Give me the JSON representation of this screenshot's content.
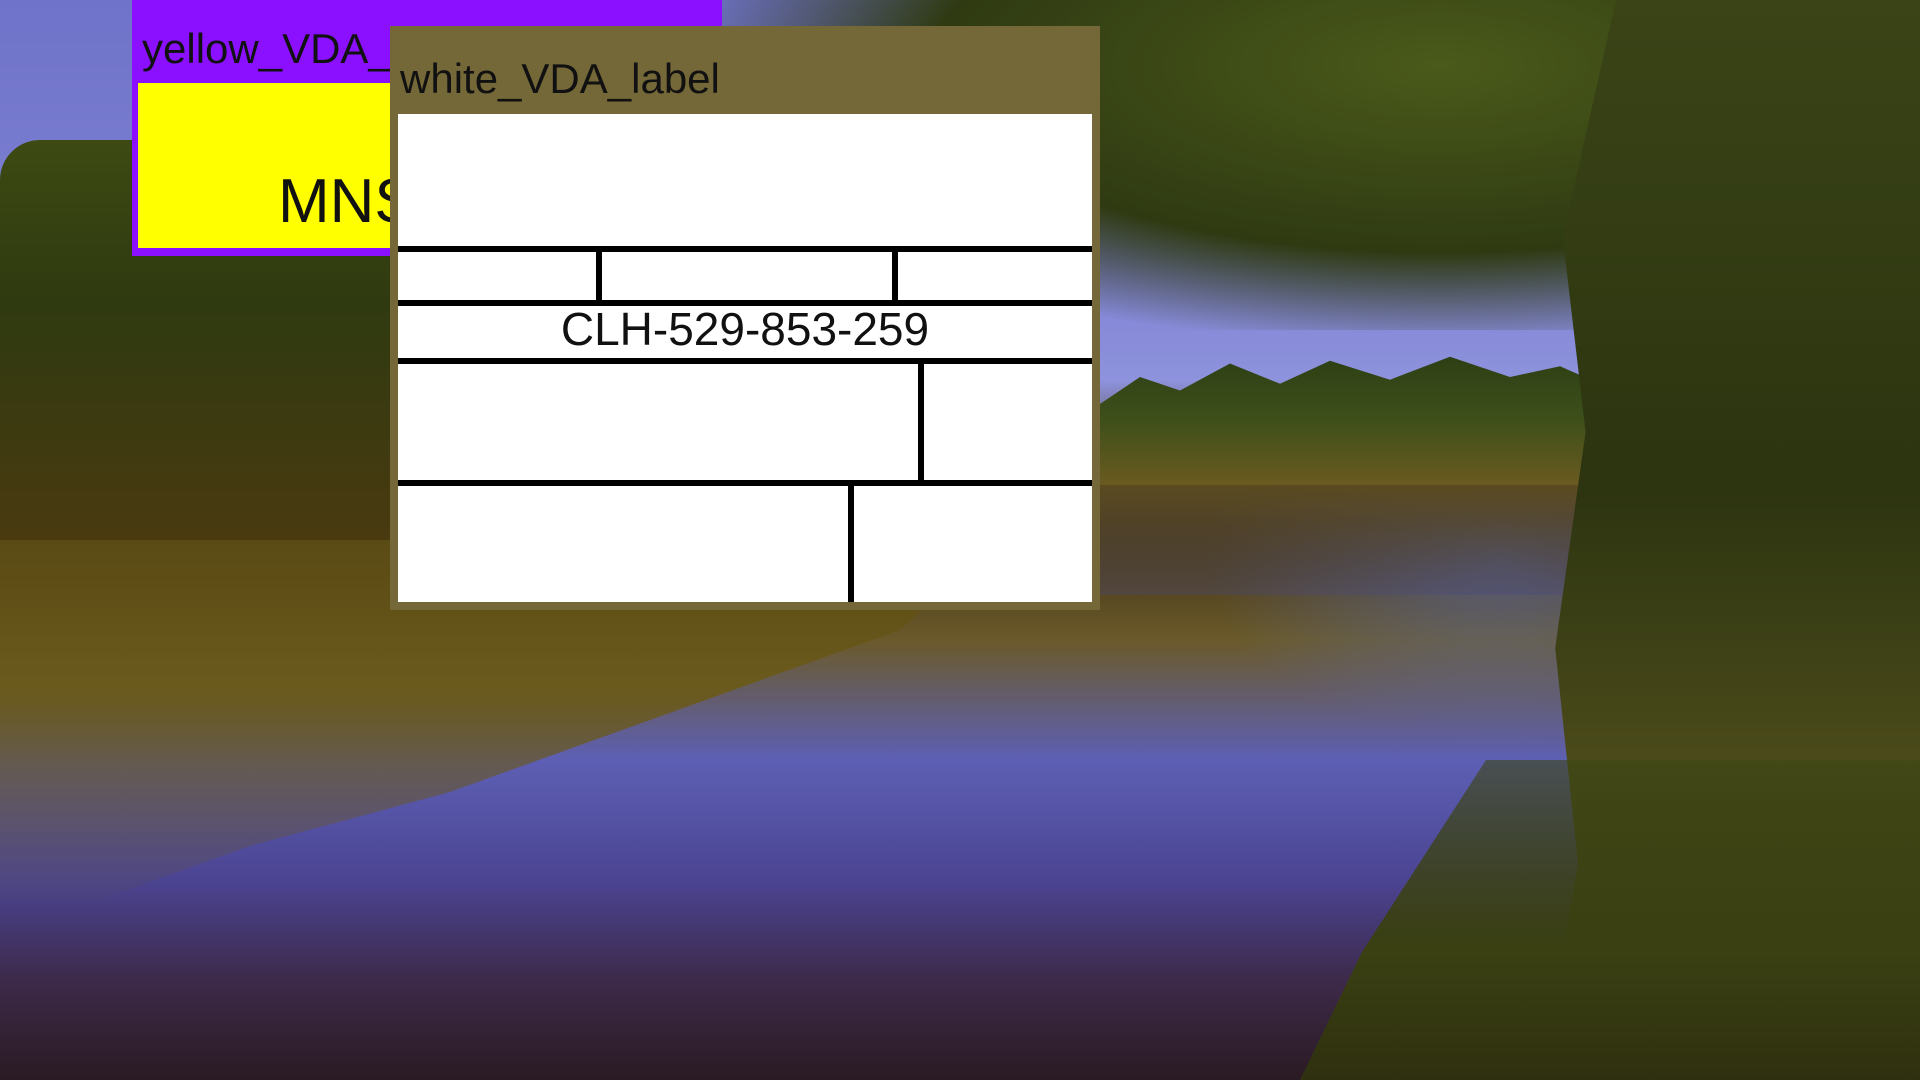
{
  "background": {
    "description_icon": "lake-landscape-wallpaper"
  },
  "windows": {
    "yellow": {
      "title": "yellow_VDA_label",
      "code": "MNS",
      "frame_color": "#8a10ff",
      "content_color": "#ffff00"
    },
    "white": {
      "title": "white_VDA_label",
      "tracking_number": "CLH-529-853-259",
      "frame_color": "#756838",
      "content_color": "#ffffff"
    }
  }
}
